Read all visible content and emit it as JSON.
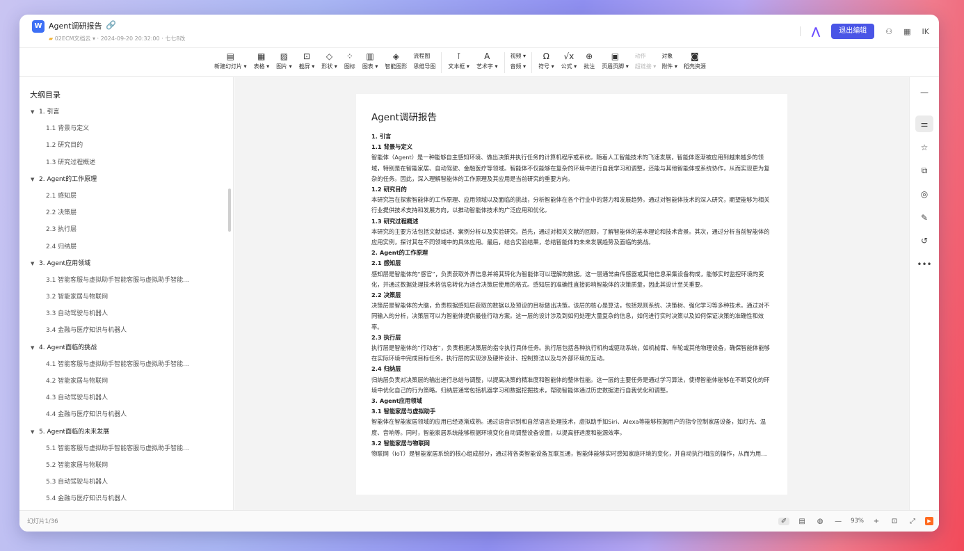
{
  "header": {
    "doc_icon": "W",
    "title": "Agent调研报告",
    "meta": "02ECM文档云 ▾ · 2024-09-20 20:32:00 · 七七8改",
    "exit_label": "退出编辑",
    "avatar_initials": "IK"
  },
  "toolbar": {
    "items": [
      {
        "icon": "new-slide-icon",
        "glyph": "▤",
        "label": "新建幻灯片 ▾"
      },
      {
        "icon": "table-icon",
        "glyph": "▦",
        "label": "表格 ▾"
      },
      {
        "icon": "image-icon",
        "glyph": "▨",
        "label": "图片 ▾"
      },
      {
        "icon": "screenshot-icon",
        "glyph": "⊡",
        "label": "截屏 ▾"
      },
      {
        "icon": "shape-icon",
        "glyph": "◇",
        "label": "形状 ▾"
      },
      {
        "icon": "icon-library-icon",
        "glyph": "⁘",
        "label": "图标"
      },
      {
        "icon": "chart-icon",
        "glyph": "▥",
        "label": "图表 ▾"
      },
      {
        "icon": "smart-graphic-icon",
        "glyph": "◈",
        "label": "智能图形"
      }
    ],
    "flow_col": [
      "流程图",
      "思维导图"
    ],
    "items2": [
      {
        "icon": "textbox-icon",
        "glyph": "⊺",
        "label": "文本框 ▾"
      },
      {
        "icon": "wordart-icon",
        "glyph": "A",
        "label": "艺术字 ▾"
      }
    ],
    "media_col": [
      "视频 ▾",
      "音频 ▾"
    ],
    "items3": [
      {
        "icon": "symbol-icon",
        "glyph": "Ω",
        "label": "符号 ▾"
      },
      {
        "icon": "formula-icon",
        "glyph": "√x",
        "label": "公式 ▾"
      },
      {
        "icon": "comment-icon",
        "glyph": "⊕",
        "label": "批注"
      },
      {
        "icon": "header-footer-icon",
        "glyph": "▣",
        "label": "页眉页脚 ▾"
      }
    ],
    "action_col": [
      "动作",
      "超链接 ▾"
    ],
    "object_col": [
      "对象",
      "附件 ▾"
    ],
    "items4": [
      {
        "icon": "sticker-icon",
        "glyph": "◙",
        "label": "稻壳资源"
      }
    ]
  },
  "outline": {
    "title": "大纲目录",
    "items": [
      {
        "level": 1,
        "text": "1. 引言"
      },
      {
        "level": 2,
        "text": "1.1 背景与定义"
      },
      {
        "level": 2,
        "text": "1.2 研究目的"
      },
      {
        "level": 2,
        "text": "1.3 研究过程概述"
      },
      {
        "level": 1,
        "text": "2. Agent的工作原理"
      },
      {
        "level": 2,
        "text": "2.1 感知层"
      },
      {
        "level": 2,
        "text": "2.2 决策层"
      },
      {
        "level": 2,
        "text": "2.3 执行层"
      },
      {
        "level": 2,
        "text": "2.4 归纳层"
      },
      {
        "level": 1,
        "text": "3. Agent应用领域"
      },
      {
        "level": 2,
        "text": "3.1 智能客服与虚拟助手智能客服与虚拟助手智能..."
      },
      {
        "level": 2,
        "text": "3.2 智能家居与物联网"
      },
      {
        "level": 2,
        "text": "3.3 自动驾驶与机器人"
      },
      {
        "level": 2,
        "text": "3.4 金融与医疗知识与机器人"
      },
      {
        "level": 1,
        "text": "4. Agent面临的挑战"
      },
      {
        "level": 2,
        "text": "4.1 智能客服与虚拟助手智能客服与虚拟助手智能..."
      },
      {
        "level": 2,
        "text": "4.2 智能家居与物联网"
      },
      {
        "level": 2,
        "text": "4.3 自动驾驶与机器人"
      },
      {
        "level": 2,
        "text": "4.4 金融与医疗知识与机器人"
      },
      {
        "level": 1,
        "text": "5. Agent面临的未来发展"
      },
      {
        "level": 2,
        "text": "5.1 智能客服与虚拟助手智能客服与虚拟助手智能..."
      },
      {
        "level": 2,
        "text": "5.2 智能家居与物联网"
      },
      {
        "level": 2,
        "text": "5.3 自动驾驶与机器人"
      },
      {
        "level": 2,
        "text": "5.4 金融与医疗知识与机器人"
      }
    ]
  },
  "slide": {
    "title": "Agent调研报告",
    "blocks": [
      {
        "type": "h",
        "text": "1. 引言"
      },
      {
        "type": "h",
        "text": "1.1 背景与定义"
      },
      {
        "type": "p",
        "text": "智能体（Agent）是一种能够自主感知环境、做出决策并执行任务的计算机程序或系统。随着人工智能技术的飞速发展，智能体逐渐被应用到越来越多的领域，特别是在智能家居、自动驾驶、金融医疗等领域。智能体不仅能够在复杂的环境中进行自我学习和调整，还能与其他智能体或系统协作，从而实现更为复杂的任务。因此，深入理解智能体的工作原理及其应用是当前研究的重要方向。"
      },
      {
        "type": "h",
        "text": "1.2 研究目的"
      },
      {
        "type": "p",
        "text": "本研究旨在探索智能体的工作原理、应用领域以及面临的挑战，分析智能体在各个行业中的潜力和发展趋势。通过对智能体技术的深入研究，期望能够为相关行业提供技术支持和发展方向，以推动智能体技术的广泛应用和优化。"
      },
      {
        "type": "h",
        "text": "1.3 研究过程概述"
      },
      {
        "type": "p",
        "text": "本研究的主要方法包括文献综述、案例分析以及实验研究。首先，通过对相关文献的回顾，了解智能体的基本理论和技术背景。其次，通过分析当前智能体的应用实例，探讨其在不同领域中的具体应用。最后，结合实验结果，总结智能体的未来发展趋势及面临的挑战。"
      },
      {
        "type": "h",
        "text": "2. Agent的工作原理"
      },
      {
        "type": "h",
        "text": "2.1 感知层"
      },
      {
        "type": "p",
        "text": "感知层是智能体的“感官”，负责获取外界信息并将其转化为智能体可以理解的数据。这一层通常由传感器或其他信息采集设备构成，能够实时监控环境的变化，并通过数据处理技术将信息转化为适合决策层使用的格式。感知层的准确性直接影响智能体的决策质量，因此其设计至关重要。"
      },
      {
        "type": "h",
        "text": "2.2 决策层"
      },
      {
        "type": "p",
        "text": "决策层是智能体的大脑，负责根据感知层获取的数据以及预设的目标做出决策。该层的核心是算法，包括规则系统、决策树、强化学习等多种技术。通过对不同输入的分析，决策层可以为智能体提供最佳行动方案。这一层的设计涉及到如何处理大量复杂的信息，如何进行实时决策以及如何保证决策的准确性和效率。"
      },
      {
        "type": "h",
        "text": "2.3 执行层"
      },
      {
        "type": "p",
        "text": "执行层是智能体的“行动者”，负责根据决策层的指令执行具体任务。执行层包括各种执行机构或驱动系统，如机械臂、车轮或其他物理设备，确保智能体能够在实际环境中完成目标任务。执行层的实现涉及硬件设计、控制算法以及与外部环境的互动。"
      },
      {
        "type": "h",
        "text": "2.4 归纳层"
      },
      {
        "type": "p",
        "text": "归纳层负责对决策层的输出进行总结与调整，以提高决策的精准度和智能体的整体性能。这一层的主要任务是通过学习算法，使得智能体能够在不断变化的环境中优化自己的行为策略。归纳层通常包括机器学习和数据挖掘技术，帮助智能体通过历史数据进行自我优化和调整。"
      },
      {
        "type": "h",
        "text": "3. Agent应用领域"
      },
      {
        "type": "h",
        "text": "3.1 智能家居与虚拟助手"
      },
      {
        "type": "p",
        "text": "智能体在智能家居领域的应用已经逐渐成熟。通过语音识别和自然语言处理技术，虚拟助手如Siri、Alexa等能够根据用户的指令控制家居设备，如灯光、温度、音响等。同时，智能家居系统能够根据环境变化自动调整设备设置，以提高舒适度和能源效率。"
      },
      {
        "type": "h",
        "text": "3.2 智能家居与物联网"
      },
      {
        "type": "c",
        "text": "物联网（IoT）是智能家居系统的核心组成部分，通过将各类智能设备互联互通，智能体能够实时感知家庭环境的变化，并自动执行相应的操作，从而为用户提供更加便捷舒适的生活体验。"
      }
    ]
  },
  "rail": {
    "icons": [
      "minimize-icon",
      "settings-sliders-icon",
      "star-icon",
      "duplicate-icon",
      "animation-icon",
      "tools-icon",
      "history-icon",
      "more-icon"
    ]
  },
  "status": {
    "slide_count": "幻灯片1/36",
    "zoom": "93%"
  }
}
